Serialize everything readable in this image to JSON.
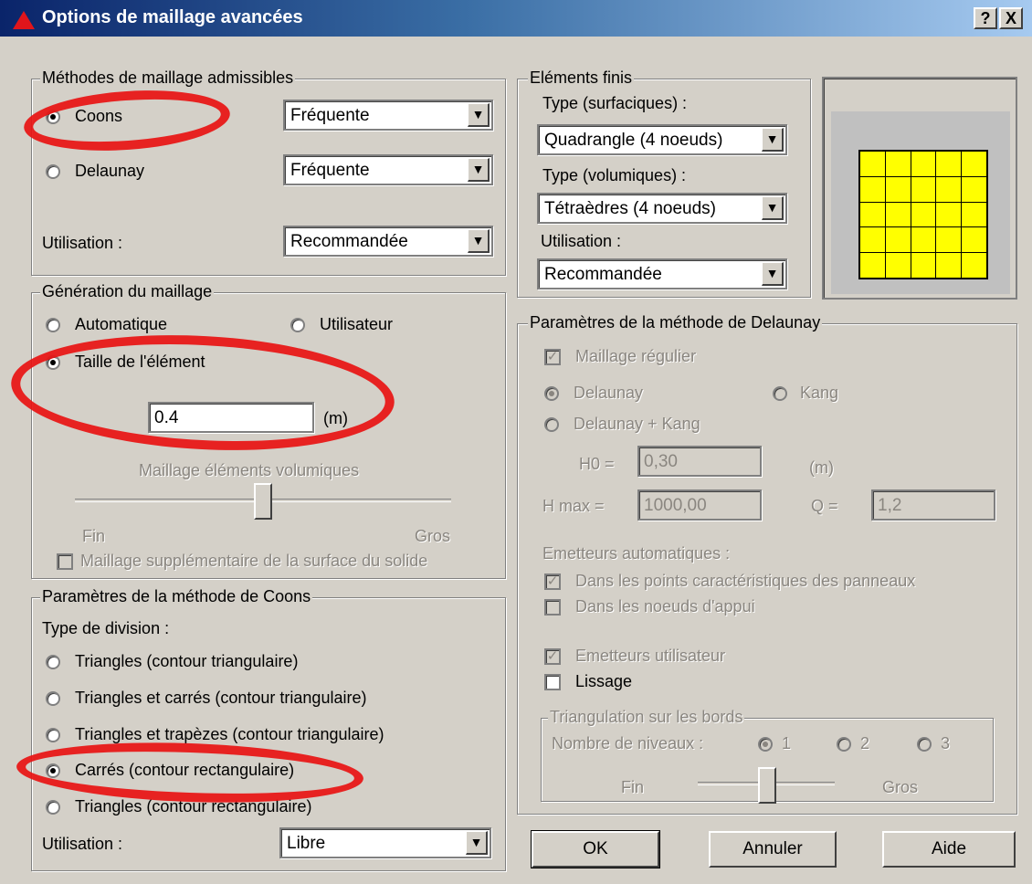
{
  "window": {
    "title": "Options de maillage avancées",
    "help_label": "?",
    "close_label": "X"
  },
  "methods": {
    "legend": "Méthodes de maillage admissibles",
    "coons_label": "Coons",
    "coons_value": "Fréquente",
    "delaunay_label": "Delaunay",
    "delaunay_value": "Fréquente",
    "usage_label": "Utilisation :",
    "usage_value": "Recommandée"
  },
  "generation": {
    "legend": "Génération du maillage",
    "auto_label": "Automatique",
    "user_label": "Utilisateur",
    "size_label": "Taille de l'élément",
    "size_value": "0.4",
    "size_unit": "(m)",
    "volumic_label": "Maillage éléments volumiques",
    "slider_min": "Fin",
    "slider_max": "Gros",
    "slider_level": 0.5,
    "extra_label": "Maillage supplémentaire de la surface du solide"
  },
  "coons": {
    "legend": "Paramètres de la méthode de Coons",
    "division_label": "Type de division :",
    "options": [
      "Triangles (contour triangulaire)",
      "Triangles et carrés (contour triangulaire)",
      "Triangles et trapèzes (contour triangulaire)",
      "Carrés (contour rectangulaire)",
      "Triangles (contour rectangulaire)"
    ],
    "usage_label": "Utilisation :",
    "usage_value": "Libre"
  },
  "finite": {
    "legend": "Eléments finis",
    "surf_label": "Type (surfaciques) :",
    "surf_value": "Quadrangle (4 noeuds)",
    "vol_label": "Type (volumiques) :",
    "vol_value": "Tétraèdres (4 noeuds)",
    "usage_label": "Utilisation :",
    "usage_value": "Recommandée"
  },
  "delaunay": {
    "legend": "Paramètres de la méthode de Delaunay",
    "regular_label": "Maillage régulier",
    "delaunay_label": "Delaunay",
    "kang_label": "Kang",
    "dk_label": "Delaunay + Kang",
    "h0_label": "H0 =",
    "h0_value": "0,30",
    "h0_unit": "(m)",
    "hmax_label": "H max =",
    "hmax_value": "1000,00",
    "q_label": "Q =",
    "q_value": "1,2",
    "emitters_label": "Emetteurs automatiques :",
    "emit_points_label": "Dans les points caractéristiques des panneaux",
    "emit_nodes_label": "Dans les noeuds d'appui",
    "emit_user_label": "Emetteurs utilisateur",
    "smoothing_label": "Lissage",
    "tri_legend": "Triangulation sur les bords",
    "levels_label": "Nombre de niveaux :",
    "level1": "1",
    "level2": "2",
    "level3": "3",
    "slider_min": "Fin",
    "slider_max": "Gros",
    "slider_level": 0.5
  },
  "buttons": {
    "ok": "OK",
    "cancel": "Annuler",
    "help": "Aide"
  },
  "preview": {
    "grid_color": "#ffff00",
    "rows": 5,
    "cols": 5
  },
  "colors": {
    "title_start": "#0a246a",
    "title_end": "#a6caf0",
    "annotation": "#e81212"
  }
}
